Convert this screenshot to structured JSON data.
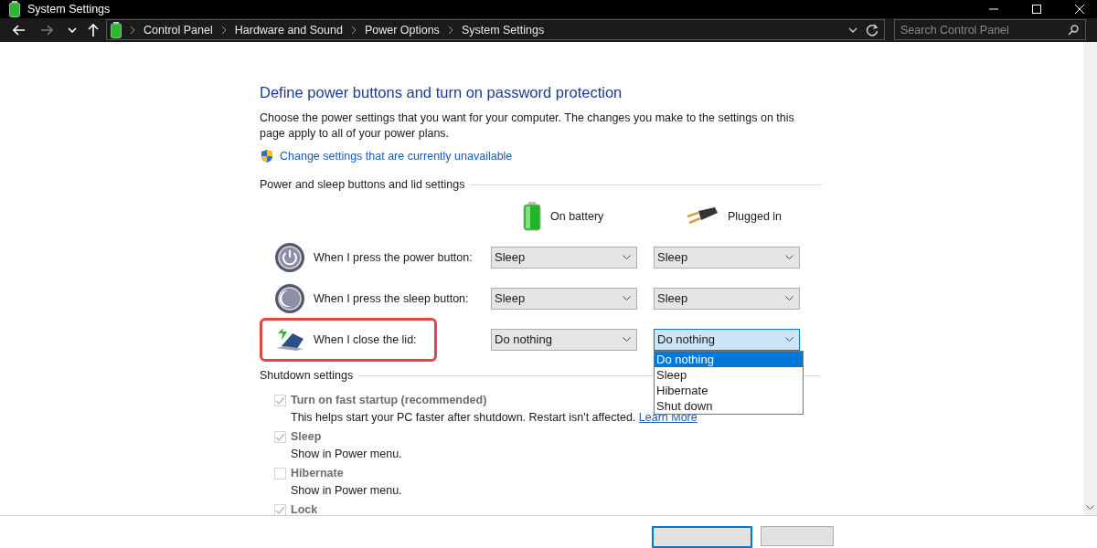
{
  "window": {
    "title": "System Settings"
  },
  "nav": {
    "forward_disabled": true
  },
  "breadcrumbs": [
    "Control Panel",
    "Hardware and Sound",
    "Power Options",
    "System Settings"
  ],
  "search": {
    "placeholder": "Search Control Panel"
  },
  "page": {
    "heading": "Define power buttons and turn on password protection",
    "description": "Choose the power settings that you want for your computer. The changes you make to the settings on this page apply to all of your power plans.",
    "link": "Change settings that are currently unavailable"
  },
  "button_settings": {
    "title": "Power and sleep buttons and lid settings",
    "columns": [
      {
        "label": "On battery",
        "kind": "battery"
      },
      {
        "label": "Plugged in",
        "kind": "plug"
      }
    ],
    "rows": [
      {
        "label": "When I press the power button:",
        "kind": "power",
        "highlighted": false,
        "selects": [
          {
            "value": "Sleep",
            "open": false
          },
          {
            "value": "Sleep",
            "open": false
          }
        ]
      },
      {
        "label": "When I press the sleep button:",
        "kind": "sleep",
        "highlighted": false,
        "selects": [
          {
            "value": "Sleep",
            "open": false
          },
          {
            "value": "Sleep",
            "open": false
          }
        ]
      },
      {
        "label": "When I close the lid:",
        "kind": "lid",
        "highlighted": true,
        "selects": [
          {
            "value": "Do nothing",
            "open": false
          },
          {
            "value": "Do nothing",
            "open": true,
            "options": [
              {
                "label": "Do nothing",
                "selected": true
              },
              {
                "label": "Sleep",
                "selected": false
              },
              {
                "label": "Hibernate",
                "selected": false
              },
              {
                "label": "Shut down",
                "selected": false
              }
            ]
          }
        ]
      }
    ]
  },
  "shutdown": {
    "title": "Shutdown settings",
    "items": [
      {
        "label": "Turn on fast startup (recommended)",
        "checked": true,
        "disabled": true,
        "description": "This helps start your PC faster after shutdown. Restart isn't affected.",
        "link": "Learn More"
      },
      {
        "label": "Sleep",
        "checked": true,
        "disabled": true,
        "description": "Show in Power menu."
      },
      {
        "label": "Hibernate",
        "checked": false,
        "disabled": true,
        "description": "Show in Power menu."
      },
      {
        "label": "Lock",
        "checked": true,
        "disabled": true
      }
    ]
  }
}
